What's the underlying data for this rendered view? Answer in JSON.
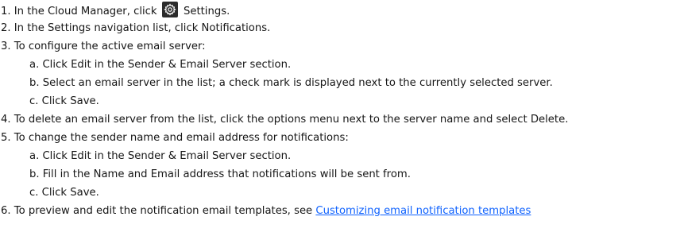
{
  "steps": {
    "s1_before": "1. In the Cloud Manager, click",
    "s1_after": "Settings.",
    "s2": "2. In the Settings navigation list, click Notifications.",
    "s3": "3. To configure the active email server:",
    "s3a": "a. Click Edit in the Sender & Email Server section.",
    "s3b": "b. Select an email server in the list; a check mark is displayed next to the currently selected server.",
    "s3c": "c. Click Save.",
    "s4": "4. To delete an email server from the list, click the options menu next to the server name and select Delete.",
    "s5": "5. To change the sender name and email address for notifications:",
    "s5a": "a. Click Edit in the Sender & Email Server section.",
    "s5b": "b. Fill in the Name and Email address that notifications will be sent from.",
    "s5c": "c. Click Save.",
    "s6_before": "6. To preview and edit the notification email templates, see",
    "s6_link": "Customizing email notification templates"
  },
  "icons": {
    "settings": "gear-icon"
  }
}
